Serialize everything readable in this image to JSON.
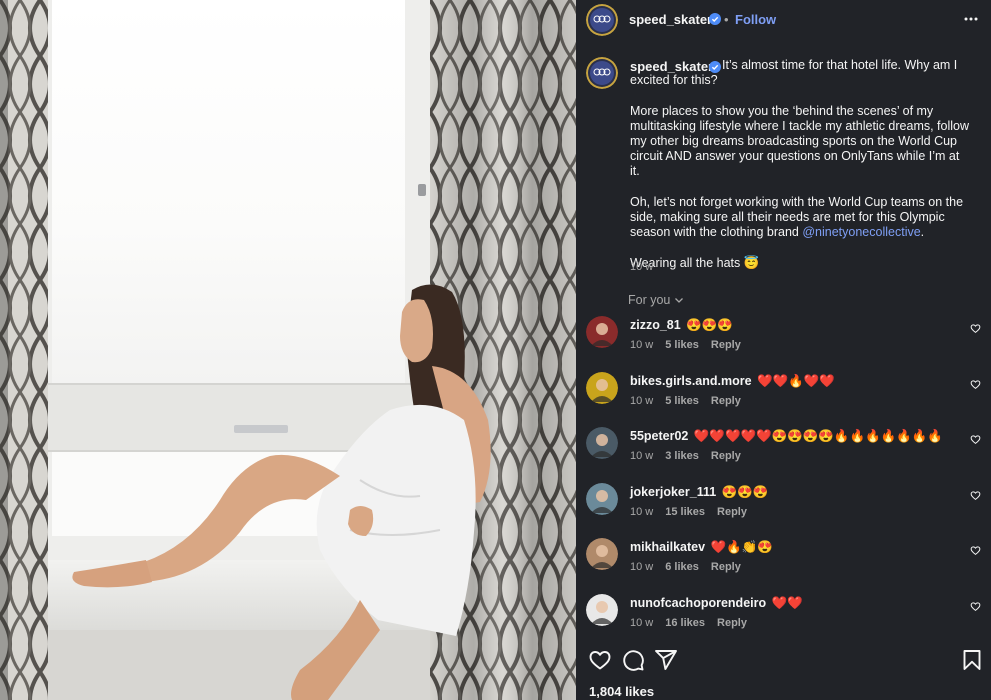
{
  "post": {
    "username": "speed_skater",
    "follow_label": "Follow",
    "separator": "•",
    "caption": {
      "username": "speed_skater",
      "paragraph1": "It’s almost time for that hotel life. Why am I excited for this?",
      "paragraph2": "More places to show you the ‘behind the scenes’ of my multitasking lifestyle where I tackle my athletic dreams, follow my other big dreams broadcasting sports on the World Cup circuit AND answer your questions on OnlyTans while I’m at it.",
      "paragraph3_text": "Oh, let’s not forget working with the World Cup teams on the side, making sure all their needs are met for this Olympic season with the clothing brand",
      "paragraph3_link": "@ninetyonecollective",
      "paragraph3_end": ".",
      "paragraph4": "Wearing all the hats 😇",
      "time": "10 w"
    },
    "for_you_label": "For you",
    "likes_total": "1,804 likes"
  },
  "comments": [
    {
      "user": "zizzo_81",
      "text": "😍😍😍",
      "time": "10 w",
      "likes": "5 likes",
      "reply": "Reply",
      "avatar_color": "#8a2b2b"
    },
    {
      "user": "bikes.girls.and.more",
      "text": "❤️❤️🔥❤️❤️",
      "time": "10 w",
      "likes": "5 likes",
      "reply": "Reply",
      "avatar_color": "#c9a41c"
    },
    {
      "user": "55peter02",
      "text": "❤️❤️❤️❤️❤️😍😍😍😍🔥🔥🔥🔥🔥🔥🔥",
      "time": "10 w",
      "likes": "3 likes",
      "reply": "Reply",
      "avatar_color": "#4a5a66"
    },
    {
      "user": "jokerjoker_111",
      "text": "😍😍😍",
      "time": "10 w",
      "likes": "15 likes",
      "reply": "Reply",
      "avatar_color": "#6b8a9a"
    },
    {
      "user": "mikhailkatev",
      "text": "❤️🔥👏😍",
      "time": "10 w",
      "likes": "6 likes",
      "reply": "Reply",
      "avatar_color": "#b08a6a"
    },
    {
      "user": "nunofcachoporendeiro",
      "text": "❤️❤️",
      "time": "10 w",
      "likes": "16 likes",
      "reply": "Reply",
      "avatar_color": "#e8e8e8"
    }
  ],
  "icons": {
    "verified": "verified-badge-icon",
    "more": "more-options-icon",
    "heart": "heart-icon",
    "comment": "comment-icon",
    "share": "share-icon",
    "save": "bookmark-icon",
    "chevron": "chevron-down-icon"
  },
  "colors": {
    "panel_bg": "#212328",
    "link": "#7f9ff5",
    "muted": "#a8a8a8",
    "verified": "#4e8cf7"
  }
}
